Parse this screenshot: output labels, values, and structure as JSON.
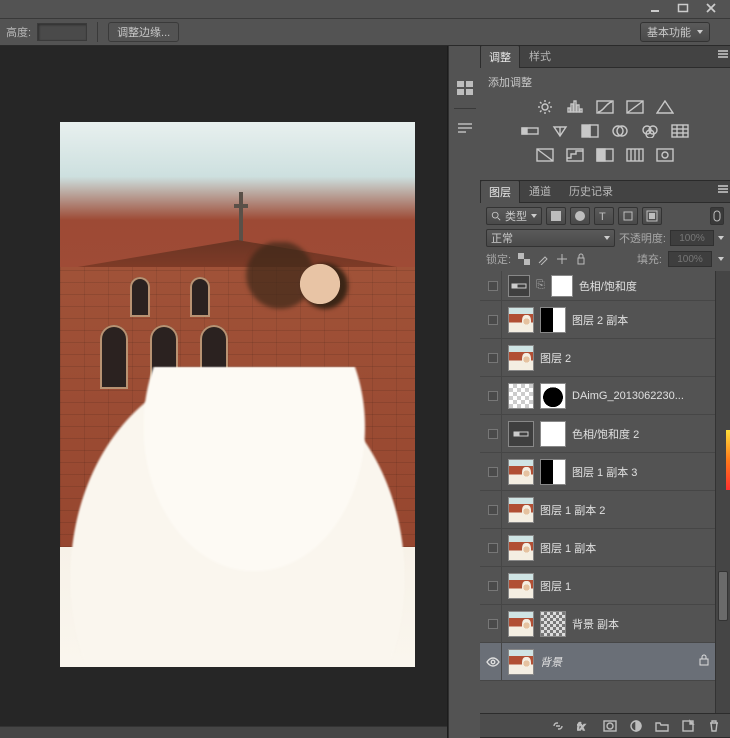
{
  "titlebar": {
    "min": "minimize",
    "max": "maximize",
    "close": "close"
  },
  "optbar": {
    "height_label": "高度:",
    "refine_edge": "调整边缘...",
    "workspace": "基本功能"
  },
  "adjust_panel": {
    "tab_adjust": "调整",
    "tab_style": "样式",
    "add_adjustment": "添加调整"
  },
  "layers_panel": {
    "tab_layers": "图层",
    "tab_channels": "通道",
    "tab_history": "历史记录",
    "filter_type": "类型",
    "blend_mode": "正常",
    "opacity_label": "不透明度:",
    "opacity_value": "100%",
    "lock_label": "锁定:",
    "fill_label": "填充:",
    "fill_value": "100%"
  },
  "layers": [
    {
      "type": "adj-cut",
      "name": "色相/饱和度"
    },
    {
      "type": "mask",
      "name": "图层 2 副本"
    },
    {
      "type": "img",
      "name": "图层 2"
    },
    {
      "type": "checker",
      "name": "DAimG_2013062230..."
    },
    {
      "type": "adj",
      "name": "色相/饱和度 2"
    },
    {
      "type": "mask",
      "name": "图层 1 副本 3"
    },
    {
      "type": "img",
      "name": "图层 1 副本 2"
    },
    {
      "type": "img",
      "name": "图层 1 副本"
    },
    {
      "type": "img",
      "name": "图层 1"
    },
    {
      "type": "masknoise",
      "name": "背景 副本"
    },
    {
      "type": "bg",
      "name": "背景",
      "selected": true,
      "visible": true,
      "locked": true
    }
  ]
}
